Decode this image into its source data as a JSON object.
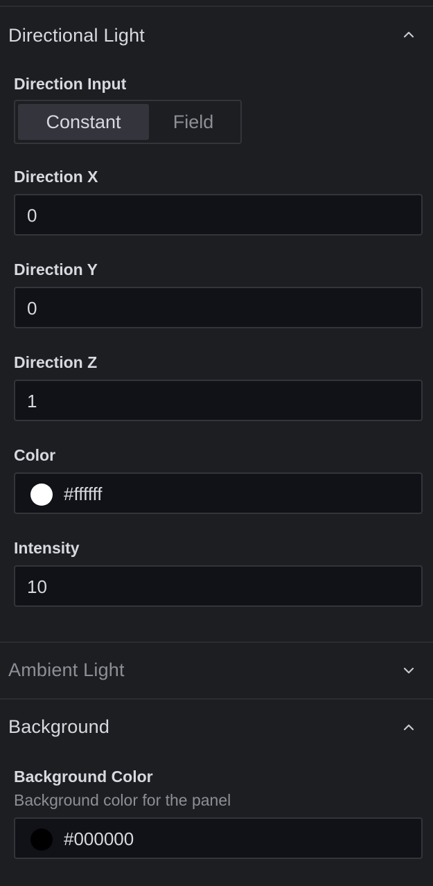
{
  "sections": {
    "directional": {
      "title": "Directional Light",
      "expanded": true,
      "direction_input": {
        "label": "Direction Input",
        "options": [
          "Constant",
          "Field"
        ],
        "selected": "Constant"
      },
      "direction_x": {
        "label": "Direction X",
        "value": "0"
      },
      "direction_y": {
        "label": "Direction Y",
        "value": "0"
      },
      "direction_z": {
        "label": "Direction Z",
        "value": "1"
      },
      "color": {
        "label": "Color",
        "value": "#ffffff",
        "swatch": "#ffffff"
      },
      "intensity": {
        "label": "Intensity",
        "value": "10"
      }
    },
    "ambient": {
      "title": "Ambient Light",
      "expanded": false
    },
    "background": {
      "title": "Background",
      "expanded": true,
      "background_color": {
        "label": "Background Color",
        "description": "Background color for the panel",
        "value": "#000000",
        "swatch": "#000000"
      }
    }
  },
  "icons": {
    "expanded": "chevron-up-icon",
    "collapsed": "chevron-down-icon"
  },
  "colors": {
    "panel_bg": "#1d1e22",
    "input_bg": "#111217",
    "border": "#34353a",
    "text": "#d8d9e0",
    "muted_text": "#8e8f96",
    "active_segment": "#34353c"
  }
}
